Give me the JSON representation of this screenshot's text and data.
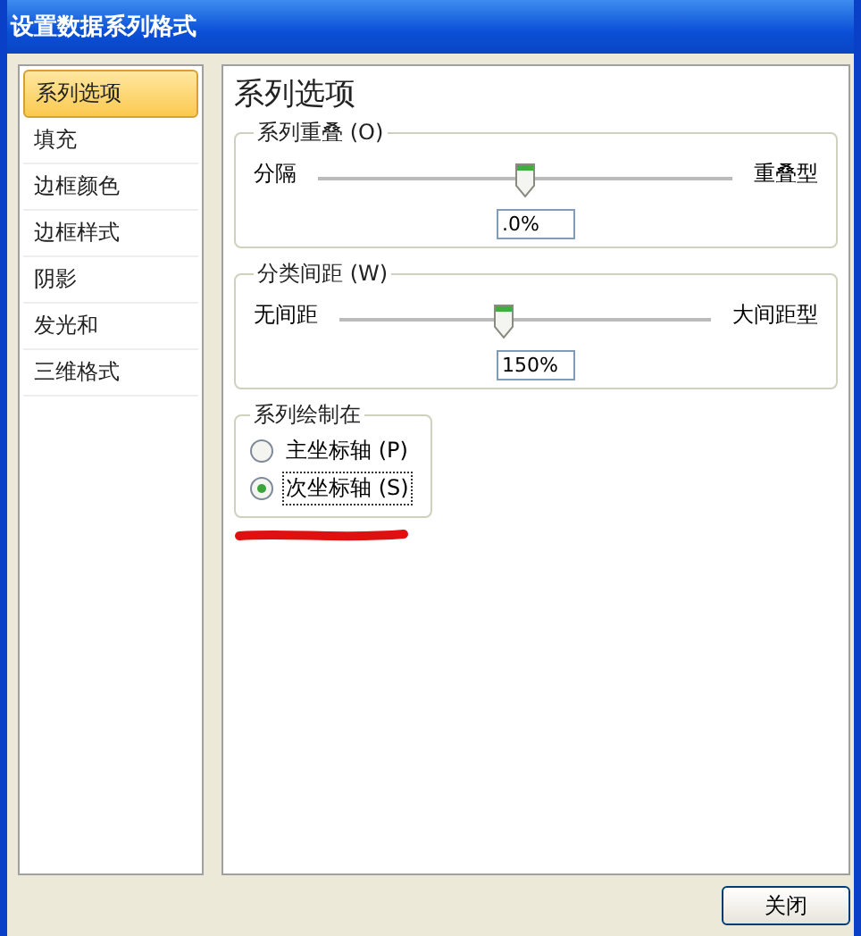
{
  "window": {
    "title": "设置数据系列格式"
  },
  "sidebar": {
    "items": [
      {
        "label": "系列选项",
        "selected": true
      },
      {
        "label": "填充",
        "selected": false
      },
      {
        "label": "边框颜色",
        "selected": false
      },
      {
        "label": "边框样式",
        "selected": false
      },
      {
        "label": "阴影",
        "selected": false
      },
      {
        "label": "发光和",
        "selected": false
      },
      {
        "label": "三维格式",
        "selected": false
      }
    ]
  },
  "panel": {
    "heading": "系列选项",
    "sliders": [
      {
        "legend": "系列重叠 (O)",
        "left_label": "分隔",
        "right_label": "重叠型",
        "level": 0.5,
        "value": ".0%"
      },
      {
        "legend": "分类间距 (W)",
        "left_label": "无间距",
        "right_label": "大间距型",
        "level": 0.44,
        "value": "150%"
      }
    ],
    "plot_on": {
      "legend": "系列绘制在",
      "options": [
        {
          "label": "主坐标轴 (P)",
          "selected": false
        },
        {
          "label": "次坐标轴 (S)",
          "selected": true
        }
      ]
    }
  },
  "buttons": [
    "关闭"
  ]
}
